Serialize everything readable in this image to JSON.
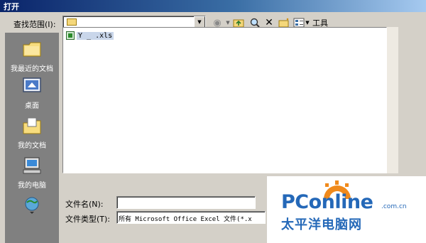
{
  "window": {
    "title": "打开"
  },
  "lookin": {
    "label": "查找范围(I):",
    "folder_name": ""
  },
  "toolbar": {
    "tools_label": "工具"
  },
  "places": [
    {
      "label": "我最近的文档",
      "icon": "recent-documents-icon"
    },
    {
      "label": "桌面",
      "icon": "desktop-icon"
    },
    {
      "label": "我的文档",
      "icon": "my-documents-icon"
    },
    {
      "label": "我的电脑",
      "icon": "my-computer-icon"
    },
    {
      "label": "",
      "icon": "network-places-icon"
    }
  ],
  "files": [
    {
      "name": "Y    _  .xls",
      "icon": "excel-file-icon"
    }
  ],
  "filename": {
    "label": "文件名(N):",
    "value": ""
  },
  "filetype": {
    "label": "文件类型(T):",
    "value": "所有 Microsoft Office Excel 文件(*.x"
  },
  "watermark": {
    "brand": "PConline",
    "domain": ".com.cn",
    "cn": "太平洋电脑网"
  },
  "colors": {
    "titlebar": "#0a246a",
    "face": "#d4d0c8",
    "places_bar": "#808080",
    "brand": "#2468b8",
    "brand_accent": "#f08a1c"
  }
}
